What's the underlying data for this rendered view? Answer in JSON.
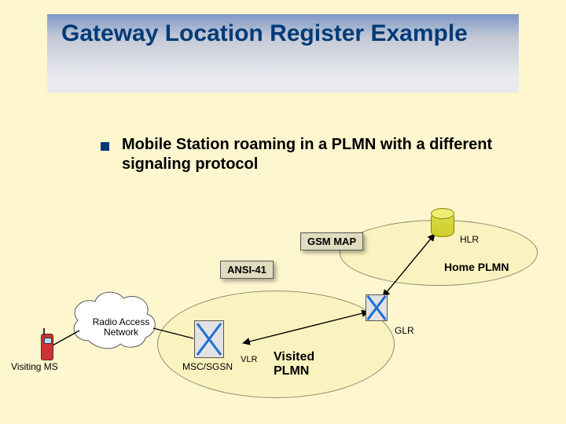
{
  "title": "Gateway Location Register Example",
  "bullet": "Mobile Station roaming in a PLMN with a different signaling protocol",
  "labels": {
    "gsm_map": "GSM MAP",
    "ansi41": "ANSI-41",
    "hlr": "HLR",
    "home_plmn": "Home PLMN",
    "glr": "GLR",
    "visited_plmn": "Visited\nPLMN",
    "vlr": "VLR",
    "msc_sgsn": "MSC/SGSN",
    "ran": "Radio Access\nNetwork",
    "visiting_ms": "Visiting MS"
  }
}
